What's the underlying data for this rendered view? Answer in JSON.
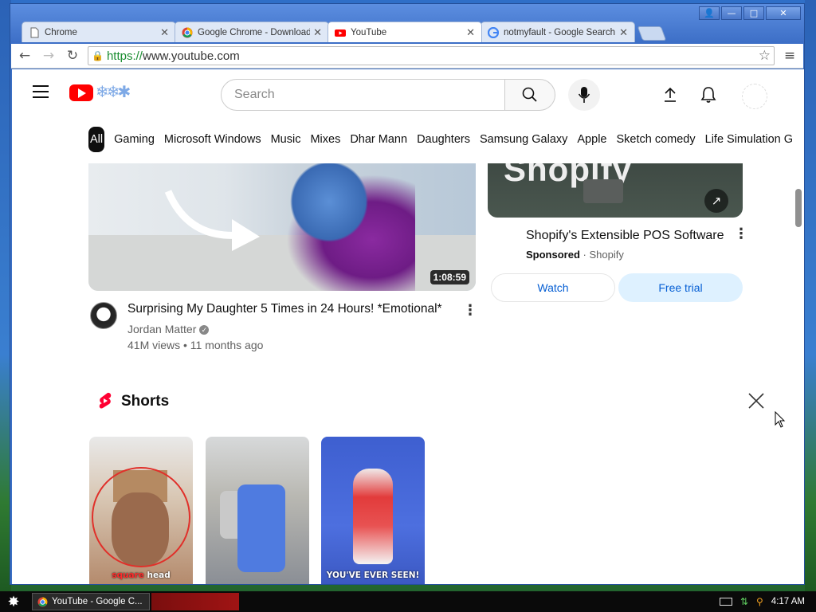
{
  "window": {
    "controls": {
      "minimize": "—",
      "maximize": "□",
      "close": "✕",
      "user": "👤"
    }
  },
  "tabs": [
    {
      "title": "Chrome",
      "favicon": "doc-icon",
      "active": false
    },
    {
      "title": "Google Chrome - Download t",
      "favicon": "chrome-icon",
      "active": false
    },
    {
      "title": "YouTube",
      "favicon": "youtube-icon",
      "active": true
    },
    {
      "title": "notmyfault - Google Search",
      "favicon": "google-icon",
      "active": false
    }
  ],
  "toolbar": {
    "url_scheme": "https://",
    "url_rest": "www.youtube.com"
  },
  "youtube": {
    "search_placeholder": "Search",
    "chips": [
      "All",
      "Gaming",
      "Microsoft Windows",
      "Music",
      "Mixes",
      "Dhar Mann",
      "Daughters",
      "Samsung Galaxy",
      "Apple",
      "Sketch comedy",
      "Life Simulation Gan"
    ],
    "video": {
      "duration": "1:08:59",
      "title": "Surprising My Daughter 5 Times in 24 Hours! *Emotional*",
      "channel": "Jordan Matter",
      "meta": "41M views • 11 months ago"
    },
    "ad": {
      "thumb_word": "Shopify",
      "title": "Shopify's Extensible POS Software",
      "sponsored": "Sponsored",
      "advertiser": "· Shopify",
      "watch_label": "Watch",
      "trial_label": "Free trial"
    },
    "shorts": {
      "title": "Shorts",
      "items": [
        {
          "caption_red": "square",
          "caption_white": " head"
        },
        {
          "caption_red": "",
          "caption_white": ""
        },
        {
          "caption_red": "",
          "caption_white": "YOU'VE EVER SEEN!"
        }
      ]
    }
  },
  "taskbar": {
    "task_label": "YouTube - Google C...",
    "time": "4:17 AM"
  },
  "colors": {
    "yt_red": "#ff0000",
    "link_blue": "#065fd4",
    "trial_bg": "#def1ff"
  }
}
